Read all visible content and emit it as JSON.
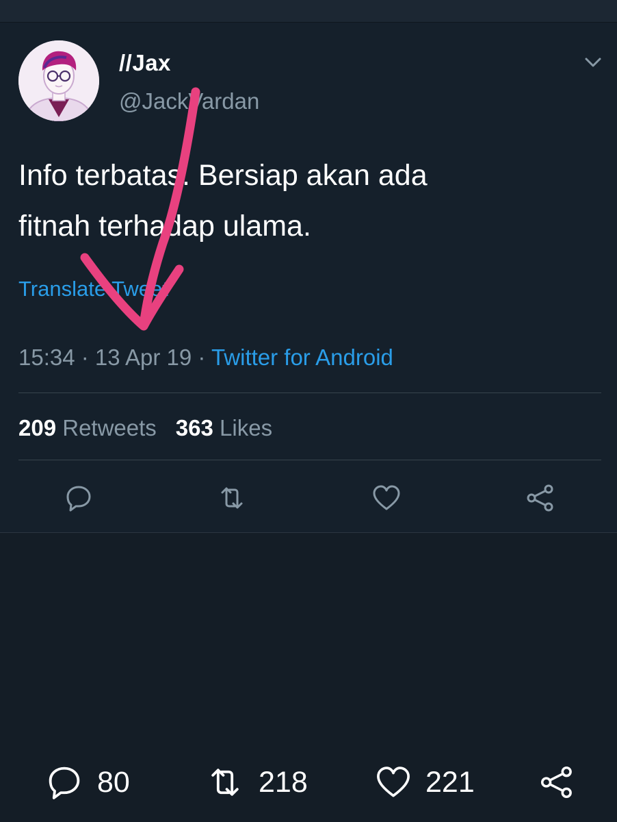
{
  "tweet": {
    "display_name": "//Jax",
    "handle": "@JackVardan",
    "text": "Info terbatas. Bersiap akan ada\nfitnah terhadap ulama.",
    "translate_label": "Translate Tweet",
    "time": "15:34",
    "date": "13 Apr 19",
    "separator": " · ",
    "source": "Twitter for Android",
    "retweet_count": "209",
    "retweet_label": "Retweets",
    "like_count": "363",
    "like_label": "Likes"
  },
  "icons": {
    "menu": "chevron-down-icon",
    "reply": "reply-icon",
    "retweet": "retweet-icon",
    "like": "heart-icon",
    "share": "share-icon",
    "annotation": "pink-arrow-annotation"
  },
  "bottom_bar": {
    "reply_count": "80",
    "retweet_count": "218",
    "like_count": "221"
  },
  "colors": {
    "background": "#15202b",
    "link": "#2a9de8",
    "muted": "#8899a6",
    "annotation": "#e8417f"
  }
}
